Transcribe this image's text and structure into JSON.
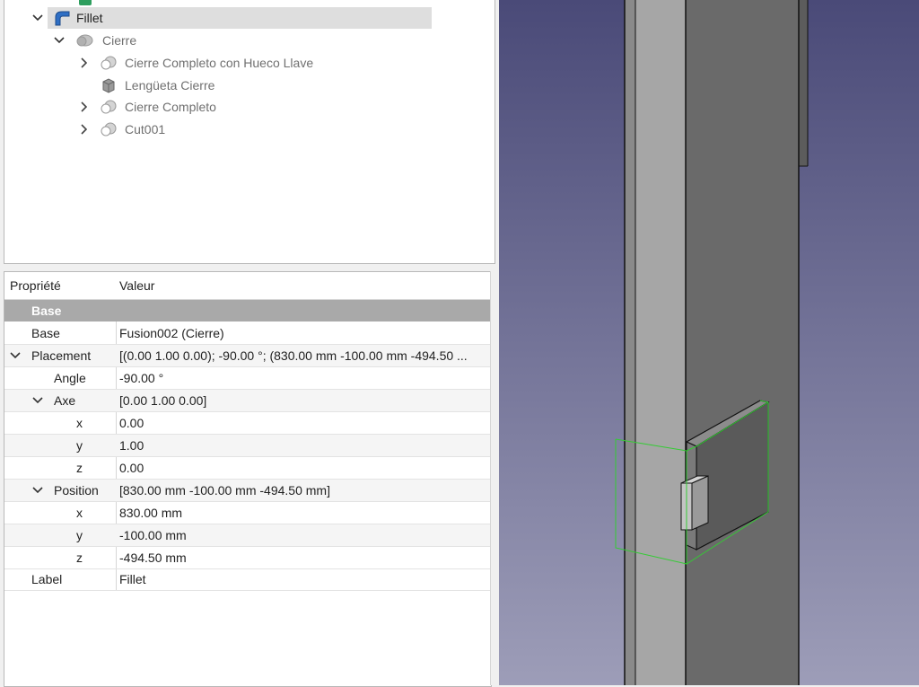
{
  "tree": {
    "items": [
      {
        "label": "Fillet",
        "icon": "fillet-icon",
        "expanded": true,
        "selected": true
      },
      {
        "label": "Cierre",
        "icon": "fusion-icon",
        "expanded": true
      },
      {
        "label": "Cierre Completo con Hueco Llave",
        "icon": "cut-icon",
        "expanded": false
      },
      {
        "label": "Lengüeta Cierre",
        "icon": "box-icon"
      },
      {
        "label": "Cierre Completo",
        "icon": "cut-icon",
        "expanded": false
      },
      {
        "label": "Cut001",
        "icon": "cut-icon",
        "expanded": false
      }
    ]
  },
  "properties": {
    "col_property": "Propriété",
    "col_value": "Valeur",
    "group": "Base",
    "rows": [
      {
        "name": "Base",
        "value": "Fusion002 (Cierre)"
      },
      {
        "name": "Placement",
        "value": "[(0.00 1.00 0.00); -90.00 °; (830.00 mm  -100.00 mm  -494.50 ..."
      },
      {
        "name": "Angle",
        "value": "-90.00 °"
      },
      {
        "name": "Axe",
        "value": "[0.00 1.00 0.00]"
      },
      {
        "name": "x",
        "value": "0.00"
      },
      {
        "name": "y",
        "value": "1.00"
      },
      {
        "name": "z",
        "value": "0.00"
      },
      {
        "name": "Position",
        "value": "[830.00 mm  -100.00 mm  -494.50 mm]"
      },
      {
        "name": "x",
        "value": "830.00 mm"
      },
      {
        "name": "y",
        "value": "-100.00 mm"
      },
      {
        "name": "z",
        "value": "-494.50 mm"
      },
      {
        "name": "Label",
        "value": "Fillet"
      }
    ]
  },
  "colors": {
    "viewport_top": "#4a4a78",
    "viewport_bottom": "#9d9db8",
    "selection_box": "#33cc33",
    "tree_selected": "#dedede",
    "group_header": "#a9a9a9"
  }
}
